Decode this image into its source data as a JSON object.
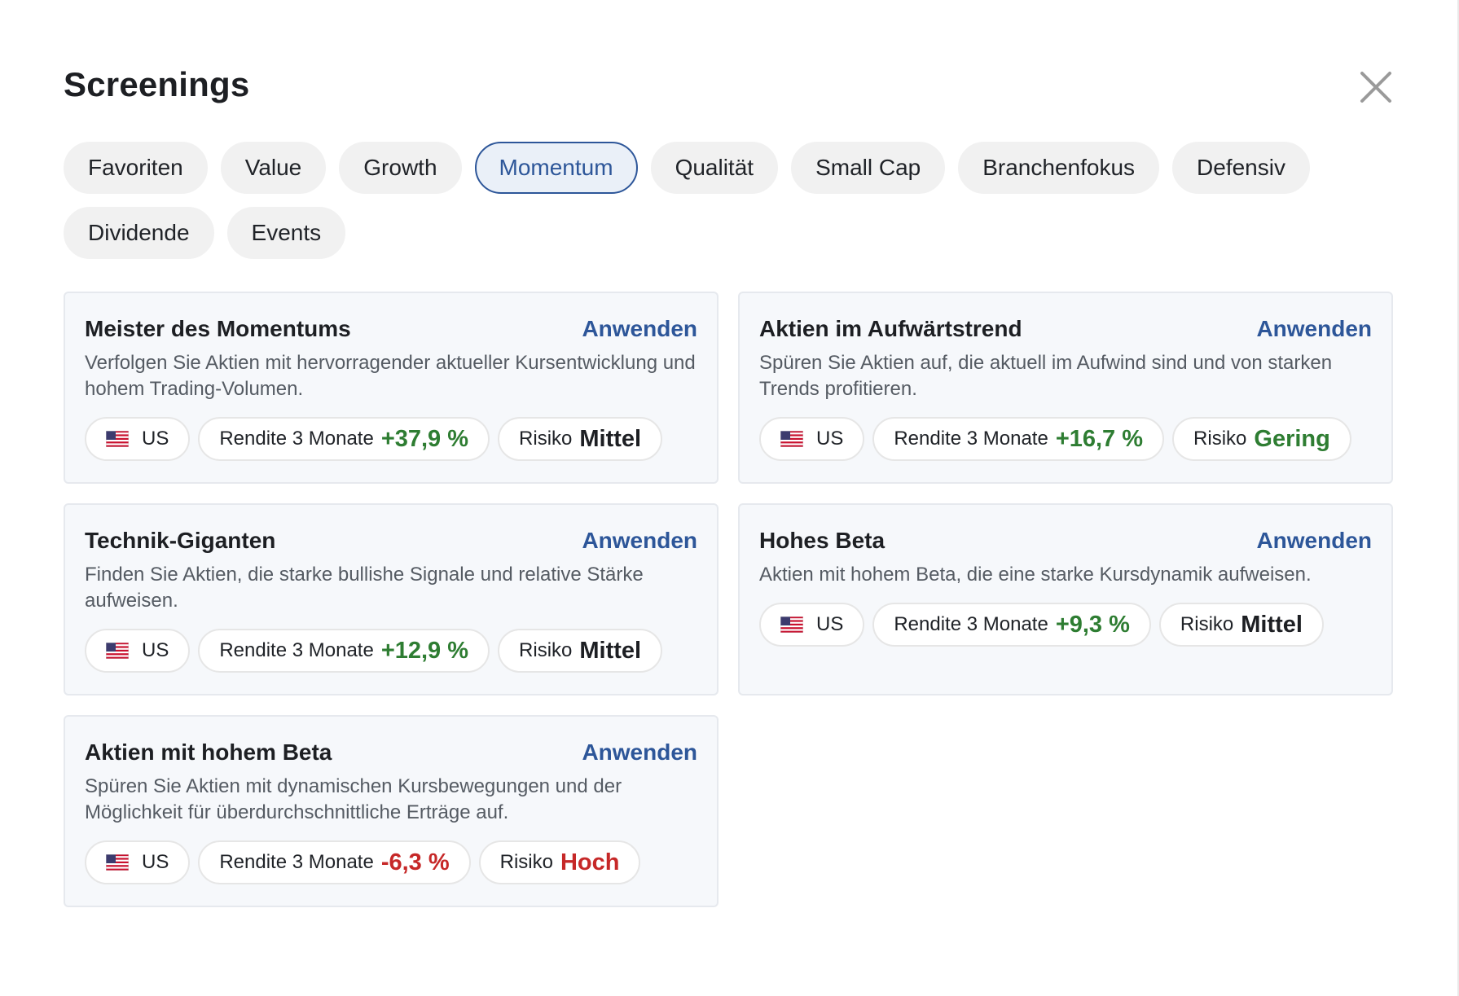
{
  "dialog": {
    "title": "Screenings",
    "close_icon": "close-icon"
  },
  "colors": {
    "accent": "#2d5699",
    "positive": "#2e7d32",
    "negative": "#c62828",
    "neutral": "#1d1f23",
    "chip_bg": "#f1f1f1",
    "card_bg": "#f6f8fb"
  },
  "categories": [
    {
      "label": "Favoriten"
    },
    {
      "label": "Value"
    },
    {
      "label": "Growth"
    },
    {
      "label": "Momentum"
    },
    {
      "label": "Qualität"
    },
    {
      "label": "Small Cap"
    },
    {
      "label": "Branchenfokus"
    },
    {
      "label": "Defensiv"
    },
    {
      "label": "Dividende"
    },
    {
      "label": "Events"
    }
  ],
  "active_category": "Momentum",
  "screeners": [
    {
      "title": "Meister des Momentums",
      "apply_label": "Anwenden",
      "description": "Verfolgen Sie Aktien mit hervorragender aktueller Kursentwicklung und hohem Trading-Volumen.",
      "region": "US",
      "return_label": "Rendite 3 Monate",
      "return_value": "+37,9 %",
      "return_sign": "positive",
      "risk_label": "Risiko",
      "risk_value": "Mittel",
      "risk_level": "neutral"
    },
    {
      "title": "Aktien im Aufwärtstrend",
      "apply_label": "Anwenden",
      "description": "Spüren Sie Aktien auf, die aktuell im Aufwind sind und von starken Trends profitieren.",
      "region": "US",
      "return_label": "Rendite 3 Monate",
      "return_value": "+16,7 %",
      "return_sign": "positive",
      "risk_label": "Risiko",
      "risk_value": "Gering",
      "risk_level": "positive"
    },
    {
      "title": "Technik-Giganten",
      "apply_label": "Anwenden",
      "description": "Finden Sie Aktien, die starke bullishe Signale und relative Stärke aufweisen.",
      "region": "US",
      "return_label": "Rendite 3 Monate",
      "return_value": "+12,9 %",
      "return_sign": "positive",
      "risk_label": "Risiko",
      "risk_value": "Mittel",
      "risk_level": "neutral"
    },
    {
      "title": "Hohes Beta",
      "apply_label": "Anwenden",
      "description": "Aktien mit hohem Beta, die eine starke Kursdynamik aufweisen.",
      "region": "US",
      "return_label": "Rendite 3 Monate",
      "return_value": "+9,3 %",
      "return_sign": "positive",
      "risk_label": "Risiko",
      "risk_value": "Mittel",
      "risk_level": "neutral",
      "short": true
    },
    {
      "title": "Aktien mit hohem Beta",
      "apply_label": "Anwenden",
      "description": "Spüren Sie Aktien mit dynamischen Kursbewegungen und der Möglichkeit für überdurchschnittliche Erträge auf.",
      "region": "US",
      "return_label": "Rendite 3 Monate",
      "return_value": "-6,3 %",
      "return_sign": "negative",
      "risk_label": "Risiko",
      "risk_value": "Hoch",
      "risk_level": "negative"
    }
  ]
}
